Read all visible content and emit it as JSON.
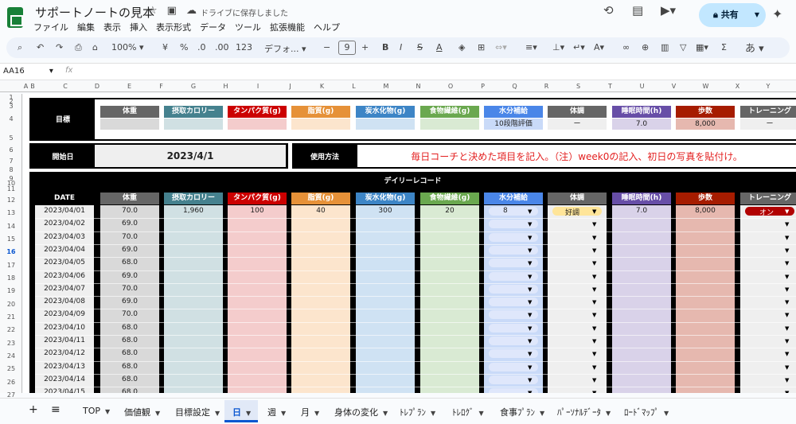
{
  "app": {
    "title": "サポートノートの見本",
    "save_status": "ドライブに保存しました",
    "menus": [
      "ファイル",
      "編集",
      "表示",
      "挿入",
      "表示形式",
      "データ",
      "ツール",
      "拡張機能",
      "ヘルプ"
    ],
    "share_label": "共有"
  },
  "toolbar": {
    "zoom": "100%",
    "currency": "¥",
    "percent": "%",
    "dec_dec": ".0",
    "dec_inc": ".00",
    "number_format": "123",
    "font": "デフォ...",
    "font_size": "9",
    "input_tool": "あ"
  },
  "formula_bar": {
    "cell_ref": "AA16",
    "fx": "fx"
  },
  "columns": [
    "A",
    "B",
    "C",
    "D",
    "E",
    "F",
    "G",
    "H",
    "I",
    "J",
    "K",
    "L",
    "M",
    "N",
    "O",
    "P",
    "Q",
    "R",
    "S",
    "T",
    "U",
    "V",
    "W",
    "X",
    "Y"
  ],
  "rows": [
    "1",
    "2",
    "3",
    "4",
    "5",
    "6",
    "7",
    "8",
    "9",
    "10",
    "11",
    "12",
    "13",
    "14",
    "15",
    "16",
    "17",
    "18",
    "19",
    "20",
    "21",
    "22",
    "23",
    "24",
    "25",
    "26",
    "27",
    "28"
  ],
  "goal": {
    "label": "目標",
    "headers": [
      "体重",
      "摂取カロリー",
      "タンパク質(g)",
      "脂質(g)",
      "炭水化物(g)",
      "食物繊維(g)",
      "水分補給",
      "体調",
      "睡眠時間(h)",
      "歩数",
      "トレーニング"
    ],
    "values": [
      "",
      "",
      "",
      "",
      "",
      "",
      "10段階評価",
      "ー",
      "7.0",
      "8,000",
      "ー"
    ]
  },
  "start": {
    "label": "開始日",
    "date": "2023/4/1"
  },
  "usage": {
    "label": "使用方法",
    "text": "毎日コーチと決めた項目を記入。（注）week0の記入、初日の写真を貼付け。"
  },
  "daily": {
    "title": "デイリーレコード",
    "date_header": "DATE",
    "headers": [
      "体重",
      "摂取カロリー",
      "タンパク質(g)",
      "脂質(g)",
      "炭水化物(g)",
      "食物繊維(g)",
      "水分補給",
      "体調",
      "睡眠時間(h)",
      "歩数",
      "トレーニング"
    ],
    "rows": [
      {
        "date": "2023/04/01",
        "weight": "70.0",
        "cal": "1,960",
        "protein": "100",
        "fat": "40",
        "carb": "300",
        "fiber": "20",
        "water": "8",
        "cond": "好調",
        "sleep": "7.0",
        "steps": "8,000",
        "training": "オン"
      },
      {
        "date": "2023/04/02",
        "weight": "69.0",
        "cal": "",
        "protein": "",
        "fat": "",
        "carb": "",
        "fiber": "",
        "water": "",
        "cond": "",
        "sleep": "",
        "steps": "",
        "training": ""
      },
      {
        "date": "2023/04/03",
        "weight": "70.0",
        "cal": "",
        "protein": "",
        "fat": "",
        "carb": "",
        "fiber": "",
        "water": "",
        "cond": "",
        "sleep": "",
        "steps": "",
        "training": ""
      },
      {
        "date": "2023/04/04",
        "weight": "69.0",
        "cal": "",
        "protein": "",
        "fat": "",
        "carb": "",
        "fiber": "",
        "water": "",
        "cond": "",
        "sleep": "",
        "steps": "",
        "training": ""
      },
      {
        "date": "2023/04/05",
        "weight": "68.0",
        "cal": "",
        "protein": "",
        "fat": "",
        "carb": "",
        "fiber": "",
        "water": "",
        "cond": "",
        "sleep": "",
        "steps": "",
        "training": ""
      },
      {
        "date": "2023/04/06",
        "weight": "69.0",
        "cal": "",
        "protein": "",
        "fat": "",
        "carb": "",
        "fiber": "",
        "water": "",
        "cond": "",
        "sleep": "",
        "steps": "",
        "training": ""
      },
      {
        "date": "2023/04/07",
        "weight": "70.0",
        "cal": "",
        "protein": "",
        "fat": "",
        "carb": "",
        "fiber": "",
        "water": "",
        "cond": "",
        "sleep": "",
        "steps": "",
        "training": ""
      },
      {
        "date": "2023/04/08",
        "weight": "69.0",
        "cal": "",
        "protein": "",
        "fat": "",
        "carb": "",
        "fiber": "",
        "water": "",
        "cond": "",
        "sleep": "",
        "steps": "",
        "training": ""
      },
      {
        "date": "2023/04/09",
        "weight": "70.0",
        "cal": "",
        "protein": "",
        "fat": "",
        "carb": "",
        "fiber": "",
        "water": "",
        "cond": "",
        "sleep": "",
        "steps": "",
        "training": ""
      },
      {
        "date": "2023/04/10",
        "weight": "68.0",
        "cal": "",
        "protein": "",
        "fat": "",
        "carb": "",
        "fiber": "",
        "water": "",
        "cond": "",
        "sleep": "",
        "steps": "",
        "training": ""
      },
      {
        "date": "2023/04/11",
        "weight": "68.0",
        "cal": "",
        "protein": "",
        "fat": "",
        "carb": "",
        "fiber": "",
        "water": "",
        "cond": "",
        "sleep": "",
        "steps": "",
        "training": ""
      },
      {
        "date": "2023/04/12",
        "weight": "68.0",
        "cal": "",
        "protein": "",
        "fat": "",
        "carb": "",
        "fiber": "",
        "water": "",
        "cond": "",
        "sleep": "",
        "steps": "",
        "training": ""
      },
      {
        "date": "2023/04/13",
        "weight": "68.0",
        "cal": "",
        "protein": "",
        "fat": "",
        "carb": "",
        "fiber": "",
        "water": "",
        "cond": "",
        "sleep": "",
        "steps": "",
        "training": ""
      },
      {
        "date": "2023/04/14",
        "weight": "68.0",
        "cal": "",
        "protein": "",
        "fat": "",
        "carb": "",
        "fiber": "",
        "water": "",
        "cond": "",
        "sleep": "",
        "steps": "",
        "training": ""
      },
      {
        "date": "2023/04/15",
        "weight": "68.0",
        "cal": "",
        "protein": "",
        "fat": "",
        "carb": "",
        "fiber": "",
        "water": "",
        "cond": "",
        "sleep": "",
        "steps": "",
        "training": ""
      }
    ]
  },
  "colors": {
    "weight": "#d9d9d9",
    "cal": "#d0e0e3",
    "protein": "#f4cccc",
    "fat": "#fce5cd",
    "carb": "#cfe2f3",
    "fiber": "#d9ead3",
    "water": "#c9daf8",
    "cond": "#efefef",
    "sleep": "#d9d2e9",
    "steps": "#e6b8af",
    "training": "#efefef",
    "h_weight": "#666666",
    "h_cal": "#45818e",
    "h_protein": "#cc0000",
    "h_fat": "#e69138",
    "h_carb": "#3d85c6",
    "h_fiber": "#6aa84f",
    "h_water": "#4a86e8",
    "h_cond": "#666666",
    "h_sleep": "#674ea7",
    "h_steps": "#a61c00",
    "h_training": "#666666",
    "usage_text": "#e31f1f",
    "date_col": "#efefef"
  },
  "sheet_tabs": [
    "TOP",
    "価値観",
    "目標設定",
    "日",
    "週",
    "月",
    "身体の変化",
    "ﾄﾚﾌﾟﾗﾝ",
    "ﾄﾚﾛｸﾞ",
    "食事ﾌﾟﾗﾝ",
    "ﾊﾟｰｿﾅﾙﾃﾞｰﾀ",
    "ﾛｰﾄﾞﾏｯﾌﾟ"
  ],
  "active_tab": "日"
}
